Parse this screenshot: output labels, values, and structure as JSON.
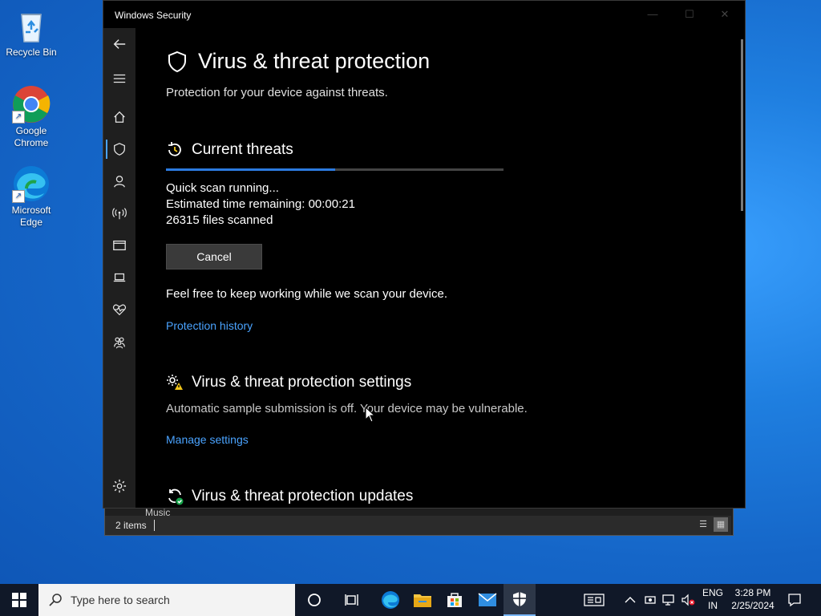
{
  "desktop": {
    "icons": [
      {
        "label": "Recycle Bin"
      },
      {
        "label": "Google Chrome"
      },
      {
        "label": "Microsoft Edge"
      }
    ]
  },
  "explorer": {
    "nav_item": "Music",
    "status_count": "2 items"
  },
  "security": {
    "window_title": "Windows Security",
    "page_title": "Virus & threat protection",
    "page_subtitle": "Protection for your device against threats.",
    "current_threats": {
      "heading": "Current threats",
      "progress_fraction": 0.5,
      "scan_status": "Quick scan running...",
      "time_remaining": "Estimated time remaining:  00:00:21",
      "files_scanned": "26315  files scanned",
      "cancel_label": "Cancel",
      "note": "Feel free to keep working while we scan your device.",
      "history_link": "Protection history"
    },
    "settings": {
      "heading": "Virus & threat protection settings",
      "message": "Automatic sample submission is off. Your device may be vulnerable.",
      "manage_link": "Manage settings"
    },
    "updates": {
      "heading": "Virus & threat protection updates"
    },
    "accent_color": "#4aa3ff"
  },
  "taskbar": {
    "search_placeholder": "Type here to search",
    "language_line1": "ENG",
    "language_line2": "IN",
    "time": "3:28 PM",
    "date": "2/25/2024"
  }
}
